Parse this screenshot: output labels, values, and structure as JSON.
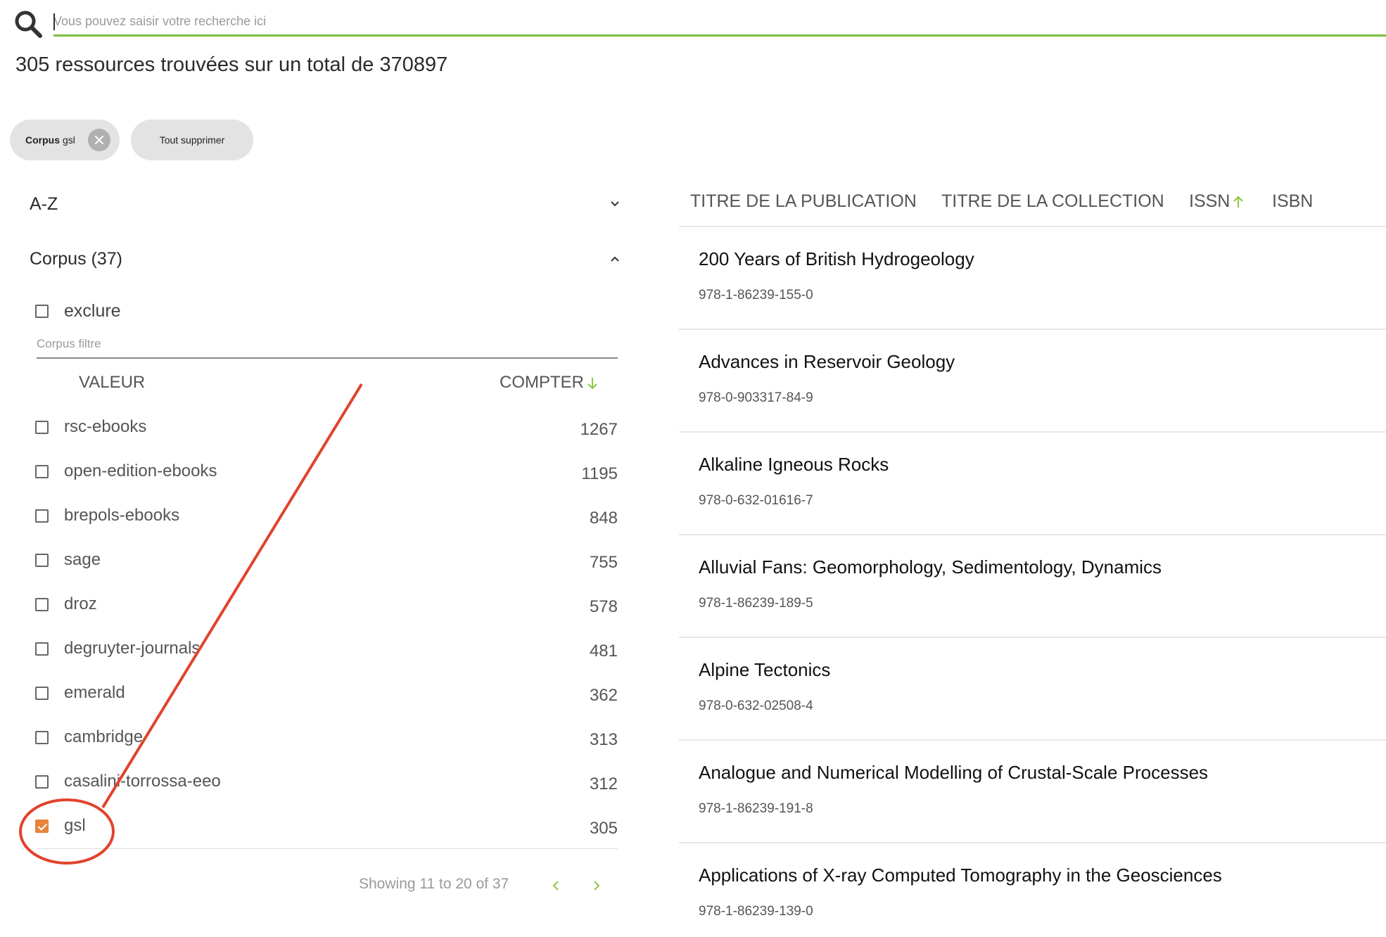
{
  "search": {
    "placeholder": "Vous pouvez saisir votre recherche ici",
    "value": ""
  },
  "results_summary": "305 ressources trouvées sur un total de 370897",
  "chips": {
    "corpus_key": "Corpus",
    "corpus_value": "gsl",
    "clear_all": "Tout supprimer"
  },
  "facets": {
    "az_label": "A-Z",
    "corpus_label": "Corpus (37)",
    "exclude_label": "exclure",
    "filter_placeholder": "Corpus filtre",
    "col_value": "VALEUR",
    "col_count": "COMPTER",
    "items": [
      {
        "label": "rsc-ebooks",
        "count": "1267",
        "checked": false
      },
      {
        "label": "open-edition-ebooks",
        "count": "1195",
        "checked": false
      },
      {
        "label": "brepols-ebooks",
        "count": "848",
        "checked": false
      },
      {
        "label": "sage",
        "count": "755",
        "checked": false
      },
      {
        "label": "droz",
        "count": "578",
        "checked": false
      },
      {
        "label": "degruyter-journals",
        "count": "481",
        "checked": false
      },
      {
        "label": "emerald",
        "count": "362",
        "checked": false
      },
      {
        "label": "cambridge",
        "count": "313",
        "checked": false
      },
      {
        "label": "casalini-torrossa-eeo",
        "count": "312",
        "checked": false
      },
      {
        "label": "gsl",
        "count": "305",
        "checked": true
      }
    ],
    "pager": "Showing 11 to 20 of 37"
  },
  "table": {
    "headers": {
      "publication": "TITRE DE LA PUBLICATION",
      "collection": "TITRE DE LA COLLECTION",
      "issn": "ISSN",
      "isbn": "ISBN"
    },
    "rows": [
      {
        "title": "200 Years of British Hydrogeology",
        "isbn": "978-1-86239-155-0"
      },
      {
        "title": "Advances in Reservoir Geology",
        "isbn": "978-0-903317-84-9"
      },
      {
        "title": "Alkaline Igneous Rocks",
        "isbn": "978-0-632-01616-7"
      },
      {
        "title": "Alluvial Fans: Geomorphology, Sedimentology, Dynamics",
        "isbn": "978-1-86239-189-5"
      },
      {
        "title": "Alpine Tectonics",
        "isbn": "978-0-632-02508-4"
      },
      {
        "title": "Analogue and Numerical Modelling of Crustal-Scale Processes",
        "isbn": "978-1-86239-191-8"
      },
      {
        "title": "Applications of X-ray Computed Tomography in the Geosciences",
        "isbn": "978-1-86239-139-0"
      }
    ]
  },
  "colors": {
    "accent_green": "#7cbf3f",
    "checked_orange": "#e8833a",
    "annotation_red": "#e0442c"
  }
}
